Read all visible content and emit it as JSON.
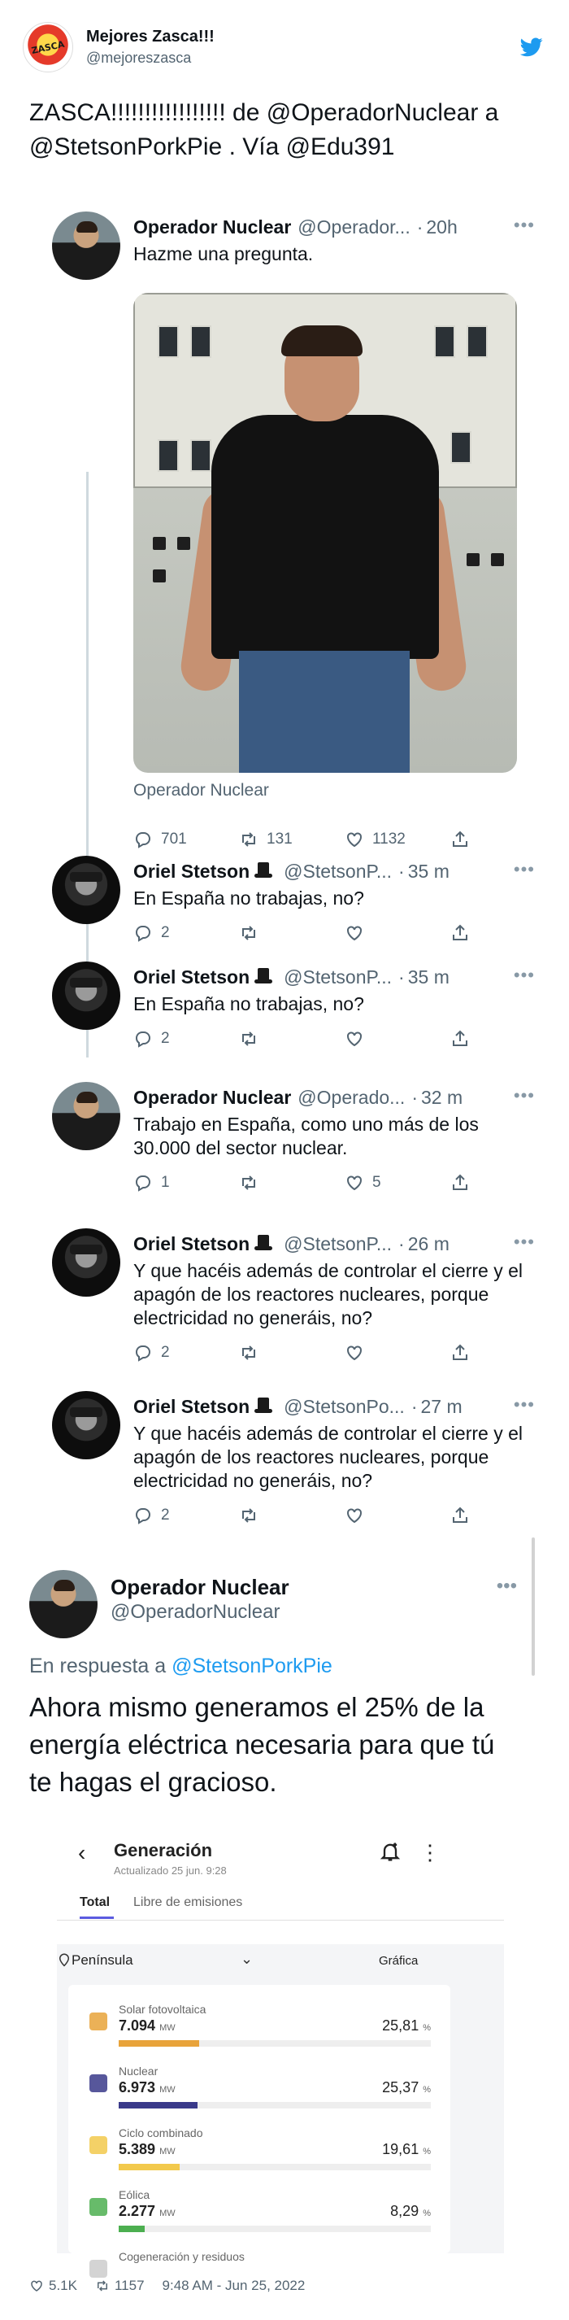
{
  "outer": {
    "name": "Mejores Zasca!!!",
    "handle": "@mejoreszasca",
    "avatar_logo_text": "ZASCA",
    "text": "ZASCA!!!!!!!!!!!!!!!!! de @OperadorNuclear a @StetsonPorkPie . Vía @Edu391",
    "likes": "5.1K",
    "retweets": "1157",
    "timestamp": "9:48 AM - Jun 25, 2022",
    "brand_color": "#1d9bf0"
  },
  "tweets": [
    {
      "name": "Operador Nuclear",
      "handle": "@Operador...",
      "time": "20h",
      "text": "Hazme una pregunta.",
      "photo_caption": "Operador Nuclear",
      "replies": "701",
      "retweets": "131",
      "likes": "1132"
    },
    {
      "name": "Oriel Stetson",
      "handle": "@StetsonP...",
      "time": "35 m",
      "text": "En España no trabajas, no?",
      "replies": "2",
      "retweets": "",
      "likes": ""
    },
    {
      "name": "Oriel Stetson",
      "handle": "@StetsonP...",
      "time": "35 m",
      "text": "En España no trabajas, no?",
      "replies": "2",
      "retweets": "",
      "likes": ""
    },
    {
      "name": "Operador Nuclear",
      "handle": "@Operado...",
      "time": "32 m",
      "text": "Trabajo en España, como uno más de los 30.000 del sector nuclear.",
      "replies": "1",
      "retweets": "",
      "likes": "5"
    },
    {
      "name": "Oriel Stetson",
      "handle": "@StetsonP...",
      "time": "26 m",
      "text": "Y que hacéis además de controlar el cierre y el apagón de los reactores nucleares, porque electricidad no generáis, no?",
      "replies": "2",
      "retweets": "",
      "likes": ""
    },
    {
      "name": "Oriel Stetson",
      "handle": "@StetsonPo...",
      "time": "27 m",
      "text": "Y que hacéis además de controlar el cierre y el apagón de los reactores nucleares, porque electricidad no generáis, no?",
      "replies": "2",
      "retweets": "",
      "likes": ""
    }
  ],
  "reply": {
    "name": "Operador Nuclear",
    "handle": "@OperadorNuclear",
    "in_reply_prefix": "En respuesta a",
    "in_reply_to": "@StetsonPorkPie",
    "text": "Ahora mismo generamos el 25% de la energía eléctrica necesaria para que tú te hagas el gracioso."
  },
  "app": {
    "title": "Generación",
    "updated": "Actualizado 25 jun. 9:28",
    "tab_total": "Total",
    "tab_libre": "Libre de emisiones",
    "region": "Península",
    "grafica": "Gráfica",
    "rows": [
      {
        "name": "Solar fotovoltaica",
        "value": "7.094",
        "unit": "MW",
        "pct": "25,81",
        "pct_unit": "%",
        "share": 0.2581,
        "color": "#e8a33a"
      },
      {
        "name": "Nuclear",
        "value": "6.973",
        "unit": "MW",
        "pct": "25,37",
        "pct_unit": "%",
        "share": 0.2537,
        "color": "#3a3a8a"
      },
      {
        "name": "Ciclo combinado",
        "value": "5.389",
        "unit": "MW",
        "pct": "19,61",
        "pct_unit": "%",
        "share": 0.1961,
        "color": "#f2c94c"
      },
      {
        "name": "Eólica",
        "value": "2.277",
        "unit": "MW",
        "pct": "8,29",
        "pct_unit": "%",
        "share": 0.0829,
        "color": "#4caf50"
      },
      {
        "name": "Cogeneración y residuos",
        "value": "",
        "unit": "",
        "pct": "",
        "pct_unit": "",
        "share": 0,
        "color": "#cccccc"
      }
    ]
  }
}
